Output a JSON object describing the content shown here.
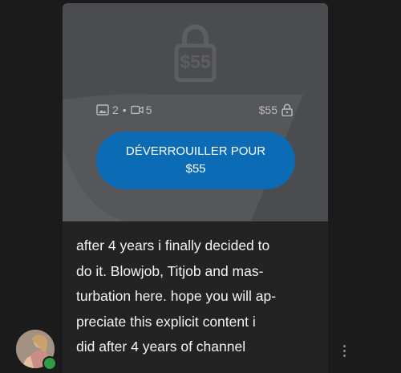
{
  "locked_media": {
    "background_price": "$55",
    "photo_count": "2",
    "separator": "•",
    "video_count": "5",
    "price": "$55",
    "unlock_button": {
      "line1": "DÉVERROUILLER POUR",
      "line2": "$55"
    }
  },
  "post": {
    "text_lines": [
      "after 4 years i finally decided to",
      "do it. Blowjob, Titjob and mas-",
      "turbation here. hope you will ap-",
      "preciate this explicit content i",
      "did after 4 years of channel"
    ]
  },
  "colors": {
    "accent": "#0c6bb5",
    "online": "#2e9c45",
    "background": "#1b1b1b",
    "card": "#232323"
  },
  "icons": [
    "lock-icon",
    "image-icon",
    "video-icon",
    "more-vertical-icon"
  ]
}
